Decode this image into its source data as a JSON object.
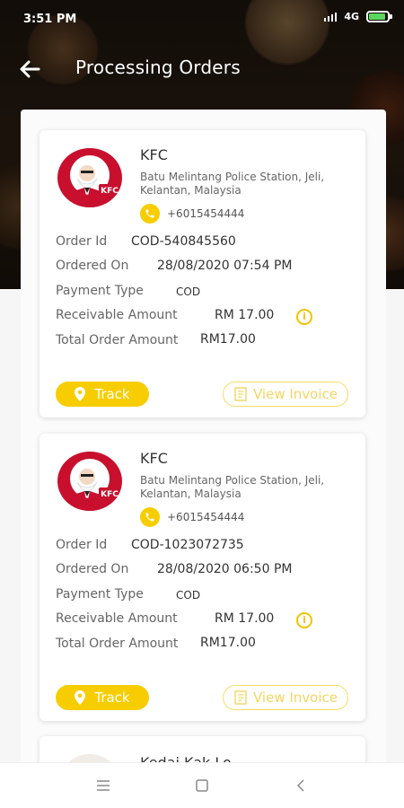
{
  "status_bar": {
    "time": "3:51 PM",
    "network": "4G"
  },
  "app_bar": {
    "title": "Processing Orders"
  },
  "orders": [
    {
      "restaurant": "KFC",
      "address": "Batu Melintang Police Station, Jeli, Kelantan, Malaysia",
      "phone": "+6015454444",
      "order_id_label": "Order Id",
      "order_id": "COD-540845560",
      "ordered_on_label": "Ordered On",
      "ordered_on": "28/08/2020 07:54 PM",
      "payment_type_label": "Payment Type",
      "payment_type": "COD",
      "receivable_label": "Receivable Amount",
      "receivable": "RM 17.00",
      "total_label": "Total Order Amount",
      "total": "RM17.00",
      "track_label": "Track",
      "invoice_label": "View Invoice"
    },
    {
      "restaurant": "KFC",
      "address": "Batu Melintang Police Station, Jeli, Kelantan, Malaysia",
      "phone": "+6015454444",
      "order_id_label": "Order Id",
      "order_id": "COD-1023072735",
      "ordered_on_label": "Ordered On",
      "ordered_on": "28/08/2020 06:50 PM",
      "payment_type_label": "Payment Type",
      "payment_type": "COD",
      "receivable_label": "Receivable Amount",
      "receivable": "RM 17.00",
      "total_label": "Total Order Amount",
      "total": "RM17.00",
      "track_label": "Track",
      "invoice_label": "View Invoice"
    },
    {
      "restaurant": "Kedai Kak Lo"
    }
  ],
  "logo": {
    "text": "KFC"
  },
  "colors": {
    "accent": "#F7CD00",
    "kfc_red": "#C8102E"
  },
  "icons": {
    "back": "arrow-left-icon",
    "phone": "phone-icon",
    "info": "info-icon",
    "location": "location-pin-icon",
    "invoice": "receipt-icon",
    "nav_menu": "menu-icon",
    "nav_home": "square-icon",
    "nav_back": "chevron-left-icon"
  }
}
